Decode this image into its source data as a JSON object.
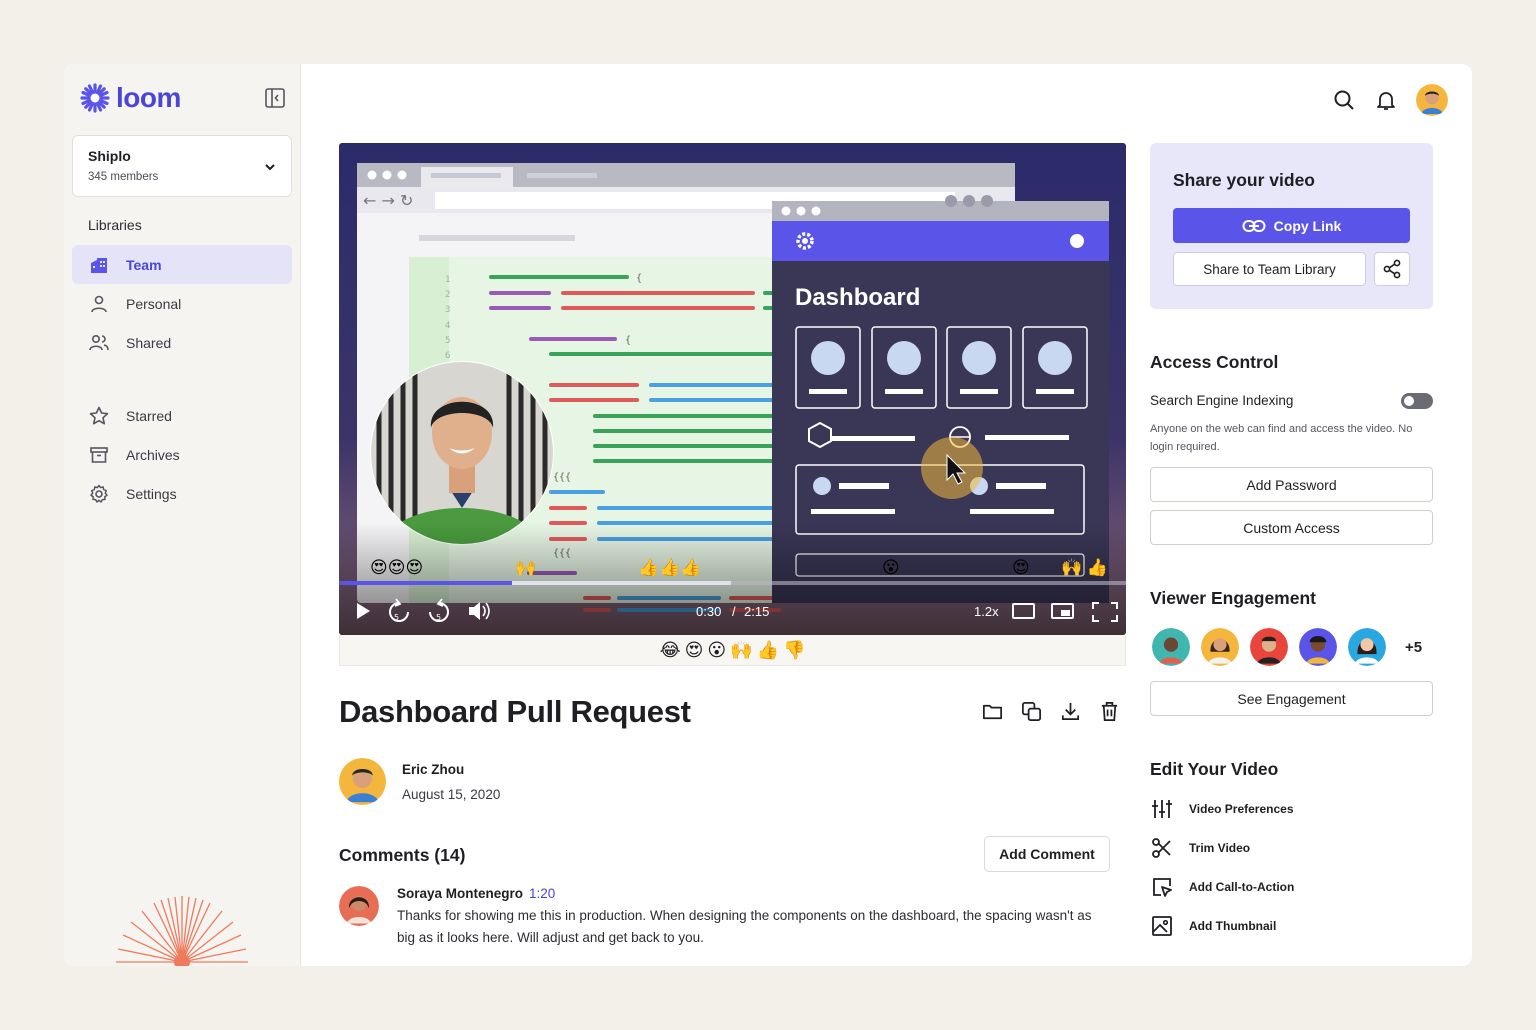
{
  "brand": {
    "name": "loom",
    "accent": "#5b54e8"
  },
  "workspace": {
    "name": "Shiplo",
    "members": "345 members"
  },
  "sidebar": {
    "libraries_title": "Libraries",
    "items": [
      {
        "label": "Team",
        "icon": "building-icon",
        "active": true
      },
      {
        "label": "Personal",
        "icon": "person-icon"
      },
      {
        "label": "Shared",
        "icon": "people-icon"
      },
      {
        "label": "Starred",
        "icon": "star-icon"
      },
      {
        "label": "Archives",
        "icon": "archive-icon"
      },
      {
        "label": "Settings",
        "icon": "gear-icon"
      }
    ]
  },
  "video": {
    "title": "Dashboard Pull Request",
    "current_time": "0:30",
    "separator": "/",
    "duration": "2:15",
    "speed": "1.2x",
    "progress": 0.22,
    "inner_dashboard_title": "Dashboard",
    "overlay_reactions": "😍😍😍",
    "overlay_reactions_2": "🙌",
    "overlay_reactions_3": "👍👍👍",
    "overlay_reactions_4": "😮",
    "overlay_reactions_5": "😍",
    "overlay_reactions_6": "🙌 👍",
    "reaction_bar": [
      "😂",
      "😍",
      "😮",
      "🙌",
      "👍",
      "👎"
    ]
  },
  "author": {
    "name": "Eric Zhou",
    "date": "August 15, 2020"
  },
  "comments": {
    "title": "Comments (14)",
    "add_label": "Add Comment",
    "items": [
      {
        "name": "Soraya Montenegro",
        "time": "1:20",
        "text": "Thanks for showing me this in production. When designing the components on the dashboard, the spacing wasn't as big as it looks here. Will adjust and get back to you."
      }
    ]
  },
  "share": {
    "title": "Share your video",
    "copy_label": "Copy Link",
    "team_label": "Share to Team Library"
  },
  "access": {
    "title": "Access Control",
    "toggle_label": "Search Engine Indexing",
    "toggle_on": false,
    "desc": "Anyone on the web can find and access the video. No login required.",
    "password_label": "Add Password",
    "custom_label": "Custom Access"
  },
  "engagement": {
    "title": "Viewer Engagement",
    "more": "+5",
    "button": "See Engagement"
  },
  "edit": {
    "title": "Edit Your Video",
    "items": [
      {
        "label": "Video Preferences",
        "icon": "sliders-icon"
      },
      {
        "label": "Trim Video",
        "icon": "scissors-icon"
      },
      {
        "label": "Add Call-to-Action",
        "icon": "cursor-click-icon"
      },
      {
        "label": "Add Thumbnail",
        "icon": "image-icon"
      }
    ]
  }
}
